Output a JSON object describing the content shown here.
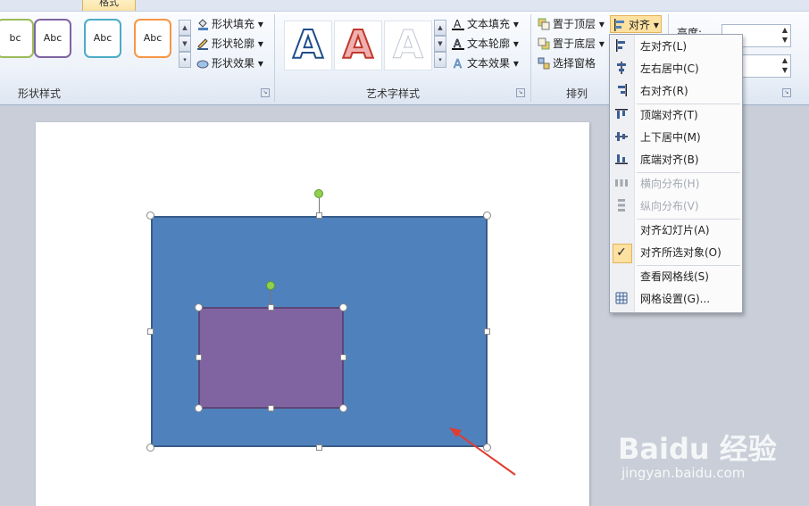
{
  "tabs": [
    {
      "label": "格式",
      "active": true
    }
  ],
  "ribbon": {
    "shape_styles": {
      "label": "形状样式",
      "thumbs": [
        {
          "text": "bc",
          "color": "#9bbb59"
        },
        {
          "text": "Abc",
          "color": "#8064a2"
        },
        {
          "text": "Abc",
          "color": "#4bacc6"
        },
        {
          "text": "Abc",
          "color": "#f79646"
        }
      ],
      "fill": "形状填充",
      "outline": "形状轮廓",
      "effects": "形状效果"
    },
    "wordart": {
      "label": "艺术字样式",
      "letter": "A",
      "text_fill": "文本填充",
      "text_outline": "文本轮廓",
      "text_effects": "文本效果"
    },
    "arrange": {
      "label": "排列",
      "bring_front": "置于顶层",
      "send_back": "置于底层",
      "selection_pane": "选择窗格",
      "align": "对齐"
    },
    "size": {
      "height_label": "高度:"
    }
  },
  "align_menu": {
    "items": [
      {
        "label": "左对齐(L)",
        "icon": "align-left-icon",
        "disabled": false
      },
      {
        "label": "左右居中(C)",
        "icon": "align-center-icon",
        "disabled": false
      },
      {
        "label": "右对齐(R)",
        "icon": "align-right-icon",
        "disabled": false
      },
      {
        "label": "顶端对齐(T)",
        "icon": "align-top-icon",
        "disabled": false
      },
      {
        "label": "上下居中(M)",
        "icon": "align-middle-icon",
        "disabled": false
      },
      {
        "label": "底端对齐(B)",
        "icon": "align-bottom-icon",
        "disabled": false
      },
      {
        "label": "横向分布(H)",
        "icon": "distribute-horizontal-icon",
        "disabled": true
      },
      {
        "label": "纵向分布(V)",
        "icon": "distribute-vertical-icon",
        "disabled": true
      },
      {
        "label": "对齐幻灯片(A)",
        "icon": "",
        "disabled": false
      },
      {
        "label": "对齐所选对象(O)",
        "icon": "checkmark-icon",
        "disabled": false,
        "checked": true
      },
      {
        "label": "查看网格线(S)",
        "icon": "",
        "disabled": false
      },
      {
        "label": "网格设置(G)...",
        "icon": "grid-icon",
        "disabled": false
      }
    ]
  },
  "canvas": {
    "blue_shape_color": "#4f81bd",
    "purple_shape_color": "#8064a2",
    "arrow_color": "#e03c31"
  },
  "watermark": {
    "text": "Baidu 经验",
    "url": "jingyan.baidu.com"
  },
  "colors": {
    "ribbon_bg": "#eef3fa",
    "highlight": "#fde1a0",
    "workspace": "#c9ced8"
  }
}
